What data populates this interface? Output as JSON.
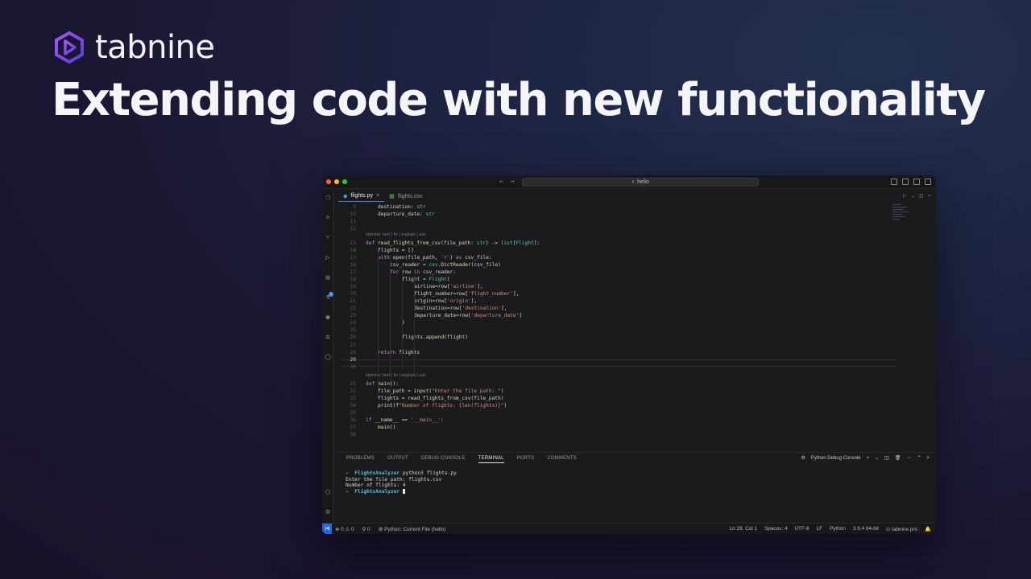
{
  "brand": {
    "name": "tabnine",
    "accent": "#7b3fe4"
  },
  "headline": "Extending code with new functionality",
  "ide": {
    "window_title": "hello",
    "tabs": [
      {
        "label": "flights.py",
        "icon": "python-icon",
        "active": true
      },
      {
        "label": "flights.csv",
        "icon": "csv-icon",
        "active": false
      }
    ],
    "lens1": "tabnine: test | fix | explain | ask",
    "lens2": "tabnine: test | fix | explain | ask",
    "lines": [
      {
        "n": "9",
        "code": "destination: str"
      },
      {
        "n": "10",
        "code": "departure_date: str"
      },
      {
        "n": "11",
        "code": ""
      },
      {
        "n": "12",
        "code": ""
      },
      {
        "n": "13",
        "code": "def read_flights_from_csv(file_path: str) -> list[Flight]:"
      },
      {
        "n": "14",
        "code": "flights = []"
      },
      {
        "n": "15",
        "code": "with open(file_path, 'r') as csv_file:"
      },
      {
        "n": "16",
        "code": "csv_reader = csv.DictReader(csv_file)"
      },
      {
        "n": "17",
        "code": "for row in csv_reader:"
      },
      {
        "n": "18",
        "code": "flight = Flight("
      },
      {
        "n": "19",
        "code": "airline=row['airline'],"
      },
      {
        "n": "20",
        "code": "flight_number=row['flight_number'],"
      },
      {
        "n": "21",
        "code": "origin=row['origin'],"
      },
      {
        "n": "22",
        "code": "destination=row['destination'],"
      },
      {
        "n": "23",
        "code": "departure_date=row['departure_date']"
      },
      {
        "n": "24",
        "code": ")"
      },
      {
        "n": "25",
        "code": ""
      },
      {
        "n": "26",
        "code": "flights.append(flight)"
      },
      {
        "n": "27",
        "code": ""
      },
      {
        "n": "28",
        "code": "return flights"
      },
      {
        "n": "29",
        "code": ""
      },
      {
        "n": "30",
        "code": ""
      },
      {
        "n": "31",
        "code": "def main():"
      },
      {
        "n": "32",
        "code": "file_path = input(\"Enter the file path: \")"
      },
      {
        "n": "33",
        "code": "flights = read_flights_from_csv(file_path)"
      },
      {
        "n": "34",
        "code": "print(f\"Number of flights: {len(flights)}\")"
      },
      {
        "n": "35",
        "code": ""
      },
      {
        "n": "36",
        "code": "if __name__ == '__main__':"
      },
      {
        "n": "37",
        "code": "main()"
      },
      {
        "n": "38",
        "code": ""
      }
    ],
    "panel_tabs": [
      "PROBLEMS",
      "OUTPUT",
      "DEBUG CONSOLE",
      "TERMINAL",
      "PORTS",
      "COMMENTS"
    ],
    "active_panel_tab": "TERMINAL",
    "panel_console": "Python Debug Console",
    "terminal": {
      "arrow": "→",
      "prompt_dir": "FlightsAnalyzer",
      "command": "python3 flights.py",
      "out1": "Enter the file path: flights.csv",
      "out2": "Number of flights: 4"
    },
    "status": {
      "errors": "0",
      "warnings": "0",
      "ports": "0",
      "run_config": "Python: Current File (hello)",
      "position": "Ln 29, Col 1",
      "spaces": "Spaces: 4",
      "encoding": "UTF-8",
      "eol": "LF",
      "language": "Python",
      "interpreter": "3.9.4 64-bit",
      "tabnine": "tabnine pro"
    }
  }
}
